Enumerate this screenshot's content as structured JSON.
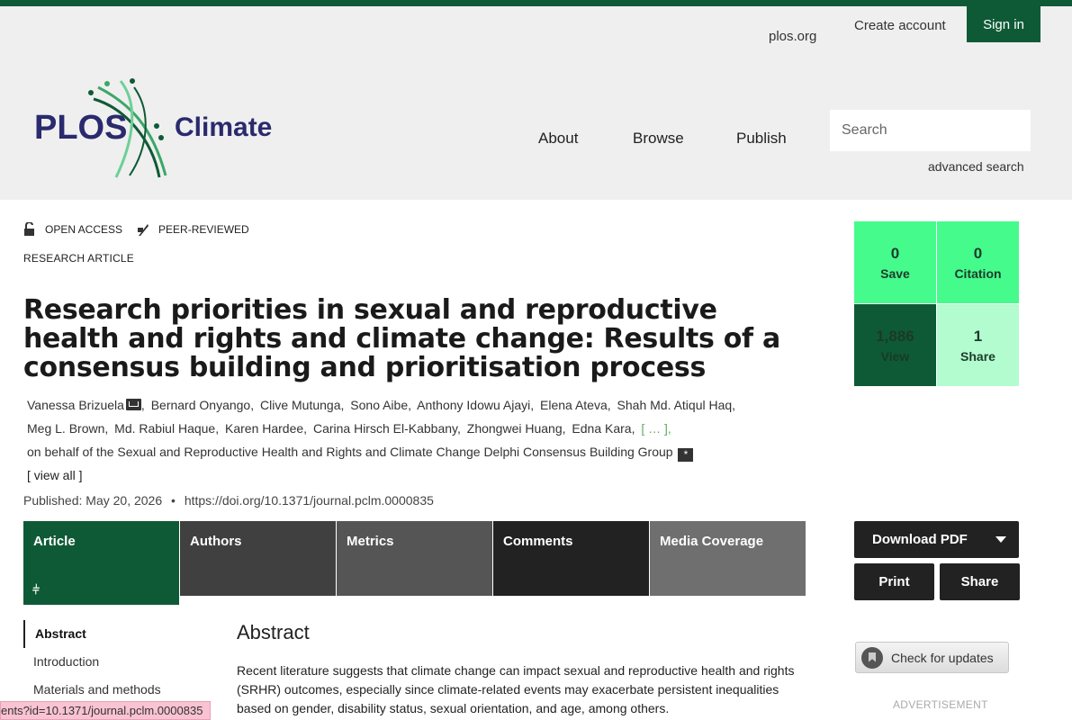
{
  "header": {
    "util_links": {
      "plos_org": "plos.org",
      "create_account": "Create account",
      "sign_in": "Sign in"
    },
    "logo": {
      "plos": "PLOS",
      "journal": "Climate"
    },
    "nav": {
      "about": "About",
      "browse": "Browse",
      "publish": "Publish"
    },
    "search": {
      "placeholder": "Search"
    },
    "advanced_search": "advanced search"
  },
  "badges": {
    "open_access": "OPEN ACCESS",
    "peer_reviewed": "PEER-REVIEWED"
  },
  "article_type": "RESEARCH ARTICLE",
  "title": "Research priorities in sexual and reproductive health and rights and climate change: Results of a consensus building and prioritisation process",
  "authors": [
    "Vanessa Brizuela",
    "Bernard Onyango,",
    "Clive Mutunga,",
    "Sono Aibe,",
    "Anthony Idowu Ajayi,",
    "Elena Ateva,",
    "Shah Md. Atiqul Haq,",
    "Meg L. Brown,",
    "Md. Rabiul Haque,",
    "Karen Hardee,",
    "Carina Hirsch El-Kabbany,",
    "Zhongwei Huang,",
    "Edna Kara,"
  ],
  "authors_ellipsis": "[ … ],",
  "group_author": "on behalf of the Sexual and Reproductive Health and Rights and Climate Change Delphi Consensus Building Group",
  "view_all": "[ view all ]",
  "published": {
    "label": "Published:",
    "date": "May 20, 2026",
    "separator": "•",
    "doi": "https://doi.org/10.1371/journal.pclm.0000835"
  },
  "tabs": [
    "Article",
    "Authors",
    "Metrics",
    "Comments",
    "Media Coverage"
  ],
  "toc": [
    "Abstract",
    "Introduction",
    "Materials and methods"
  ],
  "abstract": {
    "heading": "Abstract",
    "text": "Recent literature suggests that climate change can impact sexual and reproductive health and rights (SRHR) outcomes, especially since climate-related events may exacerbate persistent inequalities based on gender, disability status, sexual orientation, and age, among others."
  },
  "metrics": {
    "save": {
      "value": "0",
      "label": "Save"
    },
    "citation": {
      "value": "0",
      "label": "Citation"
    },
    "view": {
      "value": "1,886",
      "label": "View"
    },
    "share": {
      "value": "1",
      "label": "Share"
    }
  },
  "actions": {
    "download_pdf": "Download PDF",
    "print": "Print",
    "share": "Share"
  },
  "check_updates": "Check for updates",
  "advertisement": "ADVERTISEMENT",
  "status_url": "ents?id=10.1371/journal.pclm.0000835",
  "colors": {
    "brand_green": "#0f5a36",
    "metric_green": "#44fb8c",
    "metric_light": "#b2fcd0"
  }
}
